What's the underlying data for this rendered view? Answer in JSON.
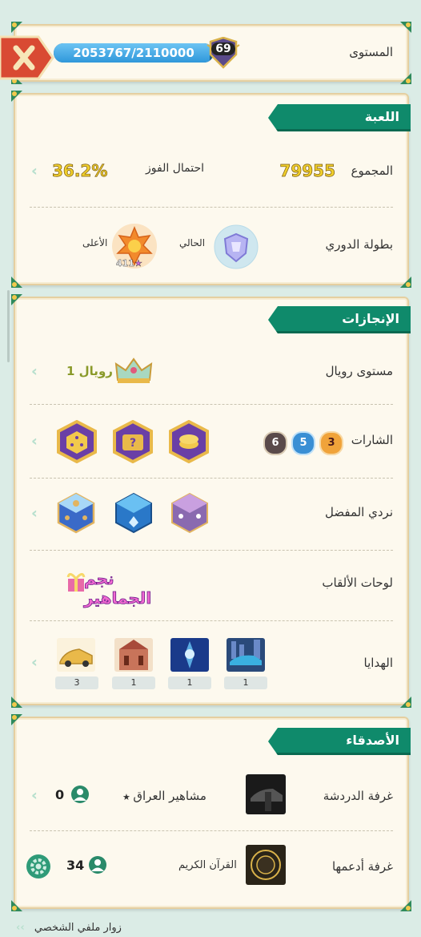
{
  "level": {
    "label": "المستوى",
    "progress_text": "2053767/2110000",
    "progress": 0.9734,
    "level_number": "69"
  },
  "game": {
    "title": "اللعبة",
    "total_label": "المجموع",
    "total_value": "79955",
    "win_label": "احتمال الفوز",
    "win_value": "36.2%",
    "league_label": "بطولة الدوري",
    "current_label": "الحالي",
    "highest_label": "الأعلى",
    "highest_stars": "411"
  },
  "achievements": {
    "title": "الإنجازات",
    "royal_label": "مستوى رويال",
    "royal_value": "رويال 1",
    "badges_label": "الشارات",
    "badge_counts": [
      "3",
      "5",
      "6"
    ],
    "dice_label": "نردي المفضل",
    "titles_label": "لوحات الألقاب",
    "title_badge": "نجم الجماهير",
    "gifts_label": "الهدايا",
    "gift_counts": [
      "1",
      "1",
      "1",
      "3"
    ]
  },
  "friends": {
    "title": "الأصدقاء",
    "chat_label": "غرفة الدردشة",
    "chat_room_name": "مشاهير العراق",
    "chat_count": "0",
    "support_label": "غرفة أدعمها",
    "support_room_name": "القرآن الكريم",
    "support_count": "34"
  },
  "visitors_label": "زوار ملفي الشخصي",
  "colors": {
    "accent": "#0f8a6b",
    "progress": "#3fa7e6",
    "close": "#d94a33"
  }
}
